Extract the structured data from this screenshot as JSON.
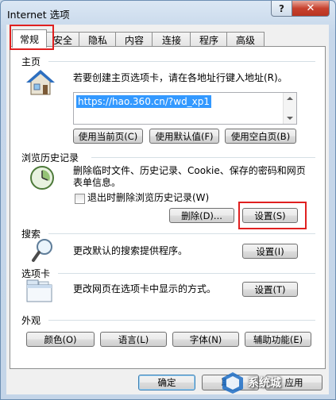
{
  "window": {
    "title": "Internet 选项",
    "help": "?",
    "close": "✕"
  },
  "tabs": [
    "常规",
    "安全",
    "隐私",
    "内容",
    "连接",
    "程序",
    "高级"
  ],
  "home": {
    "heading": "主页",
    "description": "若要创建主页选项卡，请在各地址行键入地址(R)。",
    "url": "https://hao.360.cn/?wd_xp1",
    "buttons": [
      "使用当前页(C)",
      "使用默认值(F)",
      "使用空白页(B)"
    ]
  },
  "history": {
    "heading": "浏览历史记录",
    "description_line1": "删除临时文件、历史记录、Cookie、保存的密码和网页",
    "description_line2": "表单信息。",
    "checkbox_label": "退出时删除浏览历史记录(W)",
    "delete_button": "删除(D)...",
    "settings_button": "设置(S)"
  },
  "search": {
    "heading": "搜索",
    "description": "更改默认的搜索提供程序。",
    "settings_button": "设置(I)"
  },
  "tabs_section": {
    "heading": "选项卡",
    "description": "更改网页在选项卡中显示的方式。",
    "settings_button": "设置(T)"
  },
  "appearance": {
    "heading": "外观",
    "buttons": [
      "颜色(O)",
      "语言(L)",
      "字体(N)",
      "辅助功能(E)"
    ]
  },
  "footer": {
    "ok": "确定",
    "cancel": "取消",
    "apply": "应用"
  },
  "watermark": {
    "text": "系统城"
  }
}
